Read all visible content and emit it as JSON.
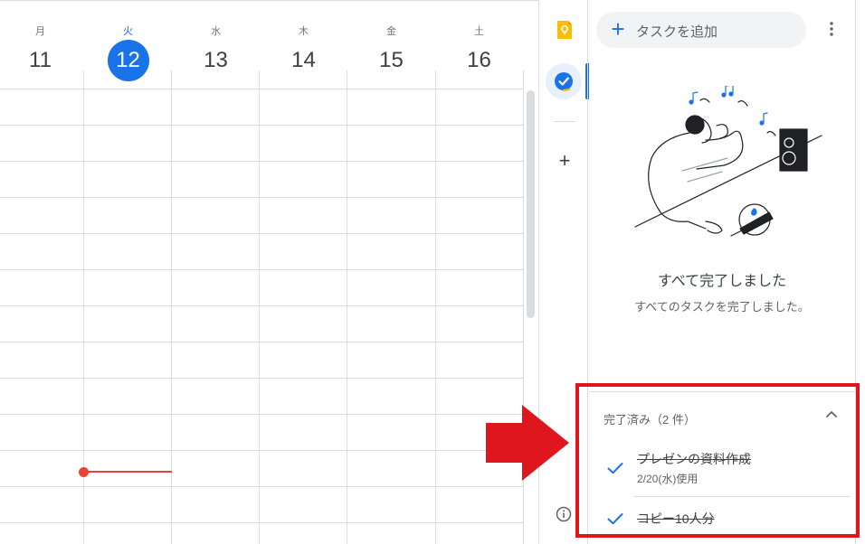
{
  "calendar": {
    "days": [
      {
        "dow": "月",
        "date": "11"
      },
      {
        "dow": "火",
        "date": "12"
      },
      {
        "dow": "水",
        "date": "13"
      },
      {
        "dow": "木",
        "date": "14"
      },
      {
        "dow": "金",
        "date": "15"
      },
      {
        "dow": "土",
        "date": "16"
      }
    ],
    "today_index": 1,
    "colors": {
      "today": "#1a73e8",
      "current_time": "#ea4335"
    }
  },
  "rail": {
    "icons": [
      "keep-icon",
      "tasks-icon",
      "add-icon",
      "info-icon"
    ]
  },
  "tasks": {
    "add_task_label": "タスクを追加",
    "empty_title": "すべて完了しました",
    "empty_subtitle": "すべてのタスクを完了しました。",
    "completed_header": "完了済み（2 件）",
    "completed_items": [
      {
        "title": "プレゼンの資料作成",
        "meta": "2/20(水)使用"
      },
      {
        "title": "コピー10人分",
        "meta": ""
      }
    ]
  },
  "annotation": {
    "color": "#e0161e"
  }
}
